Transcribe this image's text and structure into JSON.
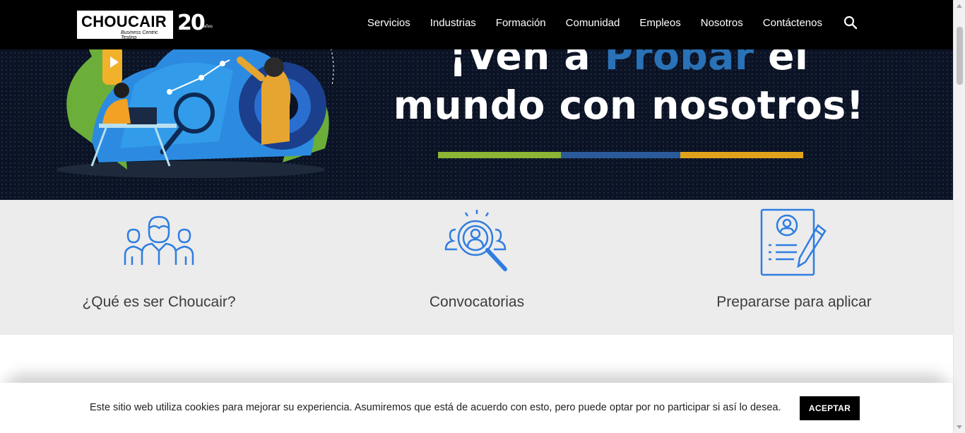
{
  "brand": {
    "name": "CHOUCAIR",
    "tagline": "Business Centric Testing",
    "anniversary": "20",
    "anniversary_sub": "años",
    "colors": {
      "header_bg": "#000000",
      "hero_bg": "#0b1324",
      "accent_blue": "#2a72b7",
      "icon_blue": "#2f7de1"
    }
  },
  "nav": {
    "items": [
      "Servicios",
      "Industrias",
      "Formación",
      "Comunidad",
      "Empleos",
      "Nosotros",
      "Contáctenos"
    ],
    "search_icon": "search-icon"
  },
  "hero": {
    "line1_prefix": "¡Ven a ",
    "line1_accent": "Probar",
    "line1_suffix": " el",
    "line2": "mundo con nosotros!",
    "bar_colors": [
      "#8bb533",
      "#2a5a9a",
      "#e0a21a"
    ]
  },
  "features": [
    {
      "label": "¿Qué es ser Choucair?",
      "icon": "team-icon"
    },
    {
      "label": "Convocatorias",
      "icon": "search-people-icon"
    },
    {
      "label": "Prepararse para aplicar",
      "icon": "resume-edit-icon"
    }
  ],
  "cookie": {
    "text": "Este sitio web utiliza cookies para mejorar su experiencia. Asumiremos que está de acuerdo con esto, pero puede optar por no participar si así lo desea.",
    "accept_label": "ACEPTAR"
  }
}
